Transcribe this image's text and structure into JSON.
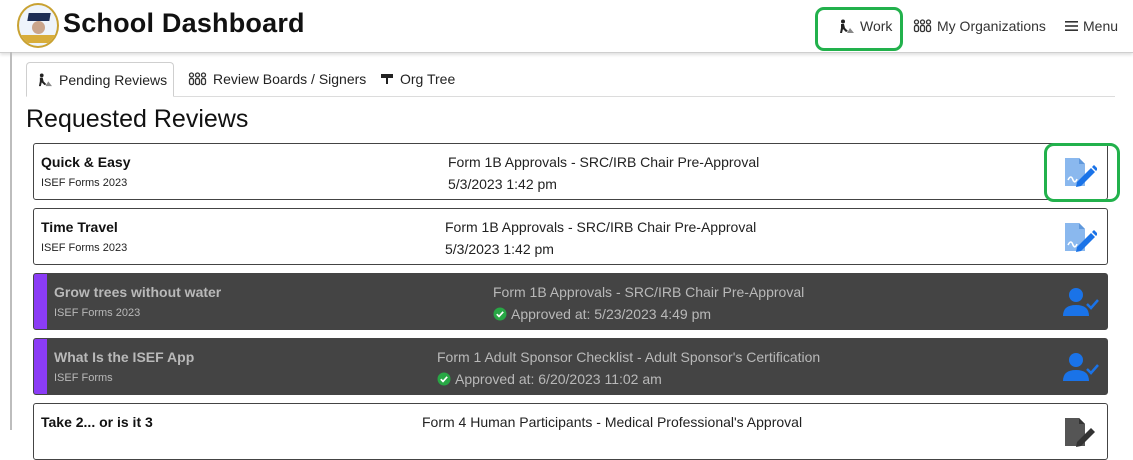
{
  "header": {
    "app_title": "School Dashboard",
    "nav": [
      {
        "label": "Work",
        "icon": "work-icon"
      },
      {
        "label": "My Organizations",
        "icon": "organizations-icon"
      },
      {
        "label": "Menu",
        "icon": "hamburger-icon"
      }
    ]
  },
  "tabs": [
    {
      "label": "Pending Reviews",
      "icon": "pending-reviews-icon",
      "active": true
    },
    {
      "label": "Review Boards / Signers",
      "icon": "review-boards-icon",
      "active": false
    },
    {
      "label": "Org Tree",
      "icon": "org-tree-icon",
      "active": false
    }
  ],
  "section_title": "Requested Reviews",
  "reviews": [
    {
      "title": "Quick & Easy",
      "subtitle": "ISEF Forms 2023",
      "form": "Form 1B Approvals - SRC/IRB Chair Pre-Approval",
      "date": "5/3/2023 1:42 pm",
      "status": "pending",
      "action_icon": "sign-document-icon"
    },
    {
      "title": "Time Travel",
      "subtitle": "ISEF Forms 2023",
      "form": "Form 1B Approvals - SRC/IRB Chair Pre-Approval",
      "date": "5/3/2023 1:42 pm",
      "status": "pending",
      "action_icon": "sign-document-icon"
    },
    {
      "title": "Grow trees without water",
      "subtitle": "ISEF Forms 2023",
      "form": "Form 1B Approvals - SRC/IRB Chair Pre-Approval",
      "date": "Approved at: 5/23/2023 4:49 pm",
      "status": "approved",
      "action_icon": "user-check-icon"
    },
    {
      "title": "What Is the ISEF App",
      "subtitle": "ISEF Forms",
      "form": "Form 1 Adult Sponsor Checklist - Adult Sponsor's Certification",
      "date": "Approved at: 6/20/2023 11:02 am",
      "status": "approved",
      "action_icon": "user-check-icon"
    },
    {
      "title": "Take 2... or is it 3",
      "subtitle": "",
      "form": "Form 4 Human Participants - Medical Professional's Approval",
      "date": "",
      "status": "pending",
      "action_icon": "sign-document-icon"
    }
  ],
  "colors": {
    "highlight": "#22b14c",
    "approved_bg": "#444444",
    "approved_stripe": "#8b3cf6",
    "action_blue": "#1a73e8",
    "check_green": "#28a745"
  }
}
